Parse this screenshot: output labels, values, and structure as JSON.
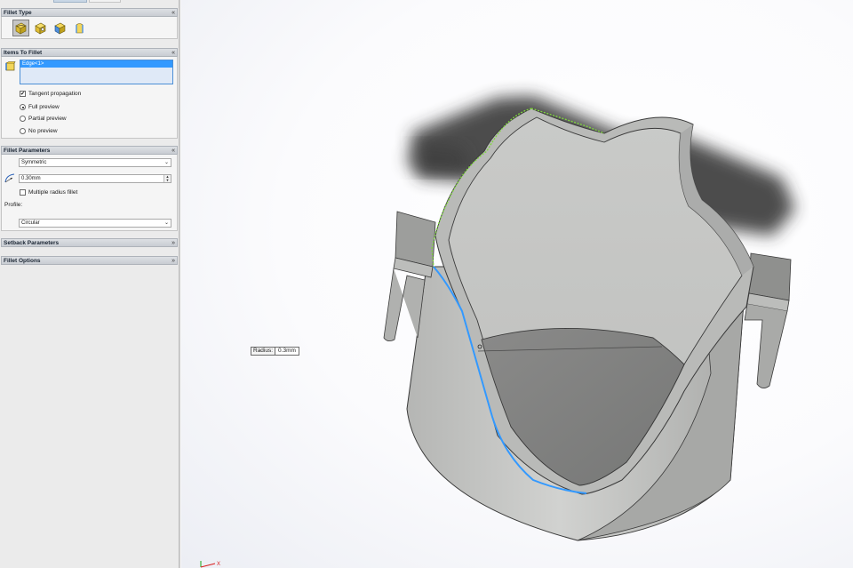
{
  "panel": {
    "sections": {
      "fillet_type": {
        "title": "Fillet Type",
        "collapse_glyph": "«"
      },
      "items_to_fillet": {
        "title": "Items To Fillet",
        "collapse_glyph": "«",
        "selected_items": [
          "Edge<1>"
        ],
        "tangent_propagation": {
          "label": "Tangent propagation",
          "checked": true
        },
        "preview_options": [
          {
            "label": "Full preview",
            "selected": true
          },
          {
            "label": "Partial preview",
            "selected": false
          },
          {
            "label": "No preview",
            "selected": false
          }
        ]
      },
      "fillet_parameters": {
        "title": "Fillet Parameters",
        "collapse_glyph": "«",
        "method": "Symmetric",
        "radius": "0.30mm",
        "multiple_radius": {
          "label": "Multiple radius fillet",
          "checked": false
        },
        "profile_label": "Profile:",
        "profile": "Circular"
      },
      "setback_parameters": {
        "title": "Setback Parameters",
        "expand_glyph": "»"
      },
      "fillet_options": {
        "title": "Fillet Options",
        "expand_glyph": "»"
      }
    },
    "fillet_type_icons": [
      "constant-radius-fillet-icon",
      "variable-radius-fillet-icon",
      "face-fillet-icon",
      "full-round-fillet-icon"
    ]
  },
  "viewport": {
    "callout": {
      "key": "Radius:",
      "value": "0.3mm"
    },
    "triad_label": "X"
  },
  "colors": {
    "selection_blue": "#3399ff",
    "preview_green": "#7fd33f",
    "part_gray": "#c8c9c7",
    "section_header": "#c8ccd2"
  }
}
